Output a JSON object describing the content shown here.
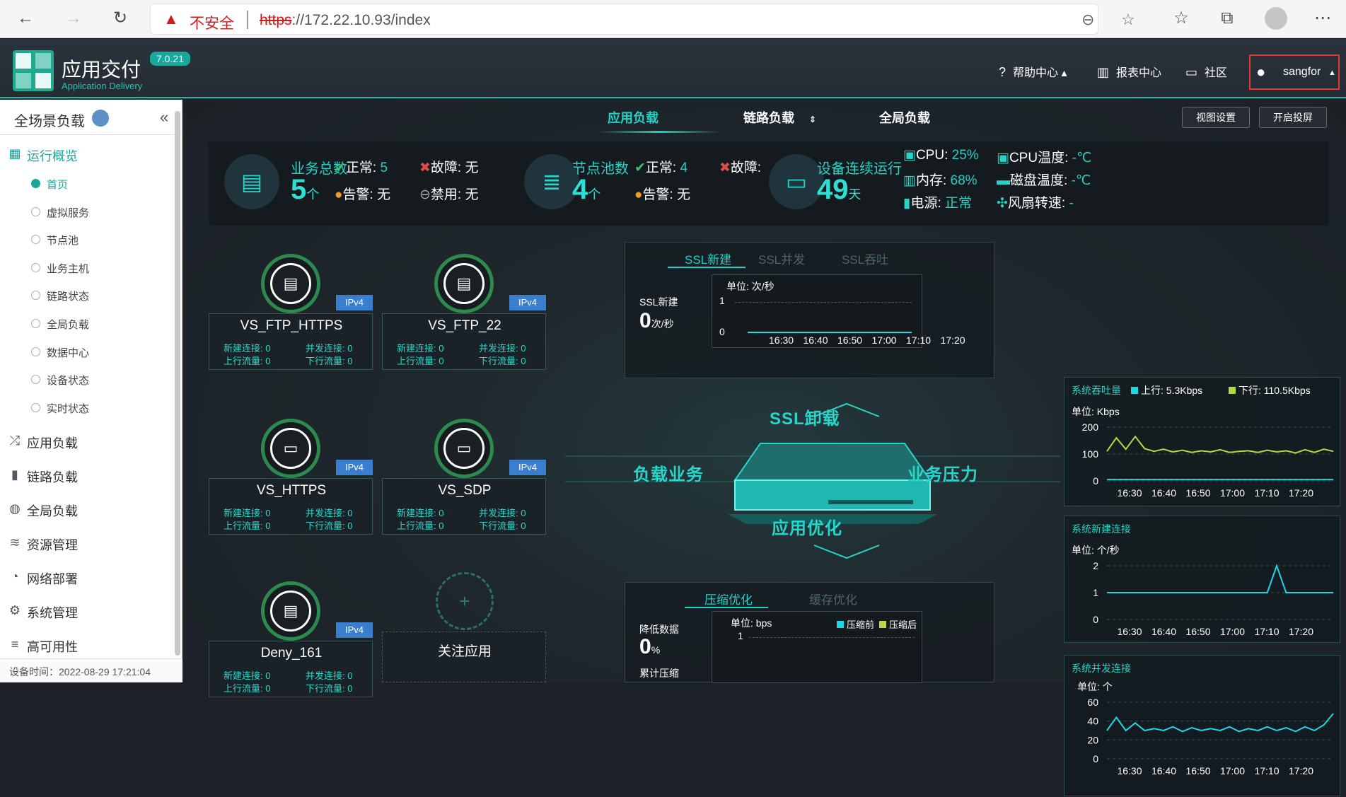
{
  "browser": {
    "insecure_label": "不安全",
    "url_scheme": "https",
    "url_rest": "://172.22.10.93/index"
  },
  "header": {
    "app_title": "应用交付",
    "app_subtitle": "Application Delivery",
    "version": "7.0.21",
    "help": "帮助中心",
    "report": "报表中心",
    "community": "社区",
    "user": "sangfor"
  },
  "sidebar": {
    "title": "全场景负载",
    "overview": "运行概览",
    "sub_items": [
      {
        "label": "首页",
        "active": true
      },
      {
        "label": "虚拟服务",
        "active": false
      },
      {
        "label": "节点池",
        "active": false
      },
      {
        "label": "业务主机",
        "active": false
      },
      {
        "label": "链路状态",
        "active": false
      },
      {
        "label": "全局负载",
        "active": false
      },
      {
        "label": "数据中心",
        "active": false
      },
      {
        "label": "设备状态",
        "active": false
      },
      {
        "label": "实时状态",
        "active": false
      }
    ],
    "groups": [
      "应用负载",
      "链路负载",
      "全局负载",
      "资源管理",
      "网络部署",
      "系统管理",
      "高可用性"
    ],
    "device_time": "设备时间：2022-08-29 17:21:04"
  },
  "tabs": [
    "应用负载",
    "链路负载",
    "全局负载"
  ],
  "buttons": {
    "view_settings": "视图设置",
    "screen": "开启投屏"
  },
  "stats": {
    "biz_total_label": "业务总数",
    "biz_total": "5",
    "unit_ge": "个",
    "normal_label": "正常:",
    "biz_normal": "5",
    "fault_label": "故障:",
    "biz_fault": "无",
    "warn_label": "告警:",
    "biz_warn": "无",
    "disabled_label": "禁用:",
    "biz_disabled": "无",
    "pool_label": "节点池数",
    "pool_total": "4",
    "pool_normal": "4",
    "pool_warn": "无",
    "uptime_label": "设备连续运行",
    "uptime": "49",
    "uptime_unit": "天",
    "cpu_label": "CPU:",
    "cpu": "25%",
    "mem_label": "内存:",
    "mem": "68%",
    "power_label": "电源:",
    "power": "正常",
    "cpu_temp_label": "CPU温度:",
    "cpu_temp": "-℃",
    "disk_temp_label": "磁盘温度:",
    "disk_temp": "-℃",
    "fan_label": "风扇转速:",
    "fan": "-"
  },
  "services": [
    {
      "name": "VS_FTP_HTTPS",
      "icon": "tcp-file-icon",
      "ip": "IPv4",
      "new_conn": "新建连接: 0",
      "conc_conn": "并发连接: 0",
      "up": "上行流量: 0",
      "down": "下行流量: 0"
    },
    {
      "name": "VS_FTP_22",
      "icon": "tcp-file-icon",
      "ip": "IPv4",
      "new_conn": "新建连接: 0",
      "conc_conn": "并发连接: 0",
      "up": "上行流量: 0",
      "down": "下行流量: 0"
    },
    {
      "name": "VS_HTTPS",
      "icon": "window-icon",
      "ip": "IPv4",
      "new_conn": "新建连接: 0",
      "conc_conn": "并发连接: 0",
      "up": "上行流量: 0",
      "down": "下行流量: 0"
    },
    {
      "name": "VS_SDP",
      "icon": "window-icon",
      "ip": "IPv4",
      "new_conn": "新建连接: 0",
      "conc_conn": "并发连接: 0",
      "up": "上行流量: 0",
      "down": "下行流量: 0"
    },
    {
      "name": "Deny_161",
      "icon": "tcp-file-icon",
      "ip": "IPv4",
      "new_conn": "新建连接: 0",
      "conc_conn": "并发连接: 0",
      "up": "上行流量: 0",
      "down": "下行流量: 0"
    }
  ],
  "add_app": "关注应用",
  "ssl": {
    "tabs": [
      "SSL新建",
      "SSL并发",
      "SSL吞吐"
    ],
    "metric_label": "SSL新建",
    "value": "0",
    "value_unit": "次/秒",
    "unit": "单位: 次/秒",
    "yticks": [
      "1",
      "0"
    ],
    "xticks": [
      "16:30",
      "16:40",
      "16:50",
      "17:00",
      "17:10",
      "17:20"
    ]
  },
  "center": {
    "ssl_offload": "SSL卸载",
    "load_biz": "负载业务",
    "biz_pressure": "业务压力",
    "app_opt": "应用优化"
  },
  "opt": {
    "tabs": [
      "压缩优化",
      "缓存优化"
    ],
    "reduce_label": "降低数据",
    "reduce_value": "0",
    "reduce_unit": "%",
    "cumulative_label": "累计压缩",
    "unit": "单位: bps",
    "legend_before": "压缩前",
    "legend_after": "压缩后",
    "ytick": "1"
  },
  "colors": {
    "accent": "#21d3c6",
    "up": "#1ed6e6",
    "down": "#b5d940"
  },
  "chart_data": [
    {
      "type": "line",
      "title": "系统吞吐量",
      "legend": [
        "上行: 5.3Kbps",
        "下行: 110.5Kbps"
      ],
      "ylabel": "单位: Kbps",
      "yticks": [
        "200",
        "100",
        "0"
      ],
      "ylim": [
        0,
        200
      ],
      "x": [
        "16:30",
        "16:40",
        "16:50",
        "17:00",
        "17:10",
        "17:20"
      ],
      "series": [
        {
          "name": "上行",
          "color": "#1ed6e6",
          "values": [
            5,
            5,
            5,
            5,
            5,
            5,
            5,
            5,
            5,
            5,
            5,
            5,
            5,
            5,
            5,
            5,
            5,
            5,
            5,
            5,
            5,
            5,
            5,
            5,
            5
          ]
        },
        {
          "name": "下行",
          "color": "#b5d940",
          "values": [
            110,
            160,
            118,
            165,
            120,
            110,
            118,
            108,
            114,
            106,
            112,
            108,
            116,
            106,
            110,
            112,
            106,
            114,
            108,
            112,
            104,
            116,
            106,
            118,
            110
          ]
        }
      ]
    },
    {
      "type": "line",
      "title": "系统新建连接",
      "ylabel": "单位: 个/秒",
      "yticks": [
        "2",
        "1",
        "0"
      ],
      "ylim": [
        0,
        2
      ],
      "x": [
        "16:30",
        "16:40",
        "16:50",
        "17:00",
        "17:10",
        "17:20"
      ],
      "series": [
        {
          "name": "新建",
          "color": "#1ed6e6",
          "values": [
            1,
            1,
            1,
            1,
            1,
            1,
            1,
            1,
            1,
            1,
            1,
            1,
            1,
            1,
            1,
            1,
            1,
            1,
            2,
            1,
            1,
            1,
            1,
            1,
            1
          ]
        }
      ]
    },
    {
      "type": "line",
      "title": "系统并发连接",
      "ylabel": "单位: 个",
      "yticks": [
        "60",
        "40",
        "20",
        "0"
      ],
      "ylim": [
        0,
        60
      ],
      "x": [
        "16:30",
        "16:40",
        "16:50",
        "17:00",
        "17:10",
        "17:20"
      ],
      "series": [
        {
          "name": "并发",
          "color": "#1ed6e6",
          "values": [
            30,
            44,
            30,
            38,
            30,
            32,
            30,
            34,
            29,
            33,
            30,
            32,
            30,
            34,
            29,
            32,
            30,
            34,
            30,
            33,
            29,
            34,
            30,
            36,
            48
          ]
        }
      ]
    }
  ]
}
